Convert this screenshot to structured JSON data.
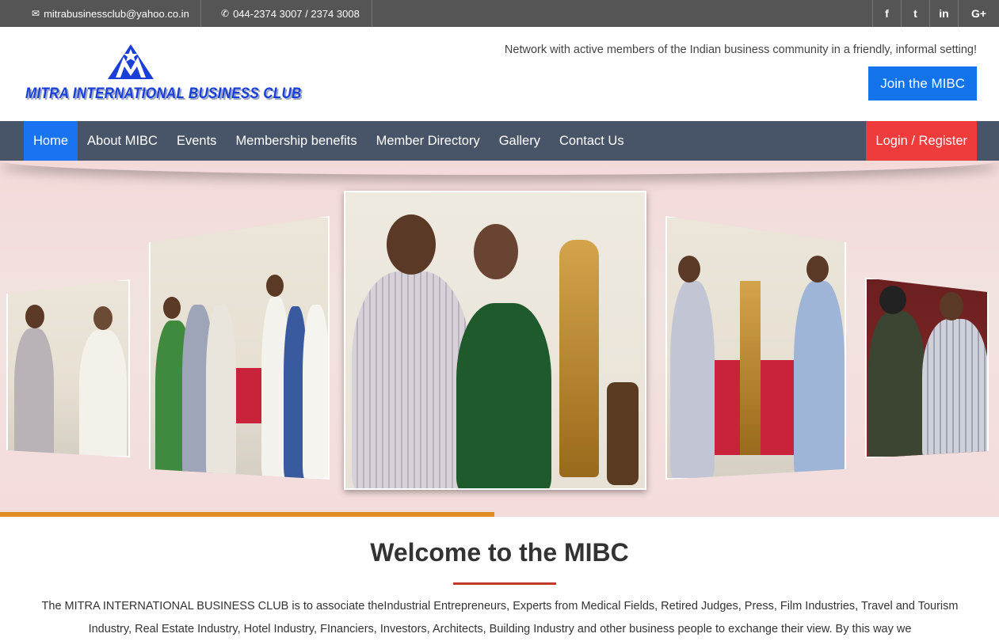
{
  "topbar": {
    "email": "mitrabusinessclub@yahoo.co.in",
    "email_icon": "envelope-icon",
    "phone": "044-2374 3007 / 2374 3008",
    "phone_icon": "phone-icon",
    "social": [
      {
        "icon": "facebook-icon",
        "glyph": "f"
      },
      {
        "icon": "twitter-icon",
        "glyph": "t"
      },
      {
        "icon": "linkedin-icon",
        "glyph": "in"
      },
      {
        "icon": "google-plus-icon",
        "glyph": "G+"
      }
    ]
  },
  "header": {
    "logo_text": "MITRA INTERNATIONAL BUSINESS CLUB",
    "tagline": "Network with active members of the Indian business community in a friendly, informal setting!",
    "join_label": "Join the MIBC"
  },
  "nav": {
    "items": [
      "Home",
      "About MIBC",
      "Events",
      "Membership benefits",
      "Member Directory",
      "Gallery",
      "Contact Us"
    ],
    "active": "Home",
    "login_label": "Login / Register"
  },
  "hero": {
    "slides_visible": 5,
    "progress_fraction": 0.495
  },
  "welcome": {
    "title": "Welcome to the MIBC",
    "body": "The MITRA INTERNATIONAL BUSINESS CLUB is to associate theIndustrial Entrepreneurs, Experts from Medical Fields, Retired Judges, Press, Film Industries, Travel and Tourism Industry, Real Estate Industry, Hotel Industry, FInanciers, Investors, Architects, Building Industry and other business people to exchange their view. By this way we"
  },
  "colors": {
    "topbar": "#555555",
    "nav": "#485468",
    "active": "#1a73f0",
    "join": "#1273ea",
    "login": "#ee3b3b",
    "progress": "#e08c1e",
    "rule": "#c0392b"
  }
}
